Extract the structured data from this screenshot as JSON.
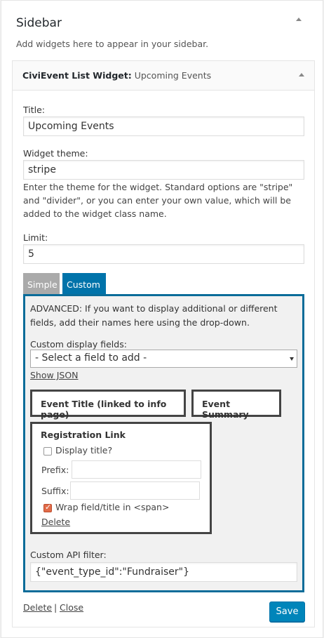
{
  "sidebar": {
    "title": "Sidebar",
    "description": "Add widgets here to appear in your sidebar."
  },
  "widget": {
    "name": "CiviEvent List Widget",
    "separator": ":",
    "instance_title": "Upcoming Events",
    "title_label": "Title:",
    "title_value": "Upcoming Events",
    "theme_label": "Widget theme:",
    "theme_value": "stripe",
    "theme_help": "Enter the theme for the widget. Standard options are \"stripe\" and \"divider\", or you can enter your own value, which will be added to the widget class name.",
    "limit_label": "Limit:",
    "limit_value": "5"
  },
  "tabs": [
    {
      "label": "Simple",
      "active": false
    },
    {
      "label": "Custom",
      "active": true
    }
  ],
  "custom": {
    "advanced_text": "ADVANCED: If you want to display additional or different fields, add their names here using the drop-down.",
    "display_fields_label": "Custom display fields:",
    "select_value": "- Select a field to add -",
    "show_json": "Show JSON",
    "field_event_title": "Event Title (linked to info page)",
    "field_event_summary": "Event Summary",
    "registration": {
      "title": "Registration Link",
      "display_title_label": "Display title?",
      "display_title_checked": false,
      "prefix_label": "Prefix:",
      "prefix_value": "",
      "suffix_label": "Suffix:",
      "suffix_value": "",
      "wrap_label": "Wrap field/title in <span>",
      "wrap_checked": true,
      "delete_label": "Delete"
    },
    "api_filter_label": "Custom API filter:",
    "api_filter_value": "{\"event_type_id\":\"Fundraiser\"}"
  },
  "footer": {
    "delete_label": "Delete",
    "separator": "|",
    "close_label": "Close",
    "save_label": "Save"
  },
  "colors": {
    "accent": "#0073aa",
    "panel_border": "#0a6c99",
    "checkbox_checked": "#e26c4a"
  }
}
